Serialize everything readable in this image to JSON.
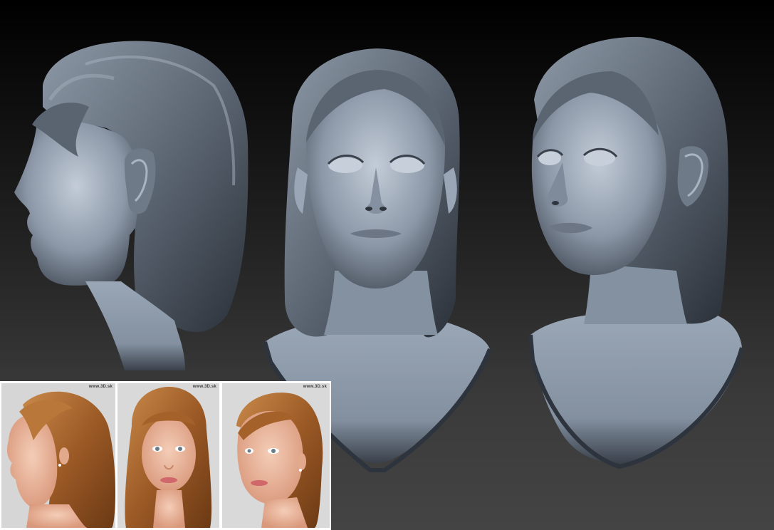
{
  "colors": {
    "clay_light": "#a9b5c3",
    "clay_mid": "#6f7a88",
    "clay_dark": "#2b3038",
    "hair_photo": "#a4612a",
    "skin_photo": "#e7b49a",
    "photo_bg": "#d9d9d9"
  },
  "renders": [
    {
      "name": "profile-left-sculpt",
      "view": "side"
    },
    {
      "name": "front-sculpt",
      "view": "front"
    },
    {
      "name": "three-quarter-sculpt",
      "view": "three-quarter"
    }
  ],
  "reference_photos": [
    {
      "view": "side",
      "watermark": "www.3D.sk"
    },
    {
      "view": "front",
      "watermark": "www.3D.sk"
    },
    {
      "view": "three-quarter",
      "watermark": "www.3D.sk"
    }
  ]
}
